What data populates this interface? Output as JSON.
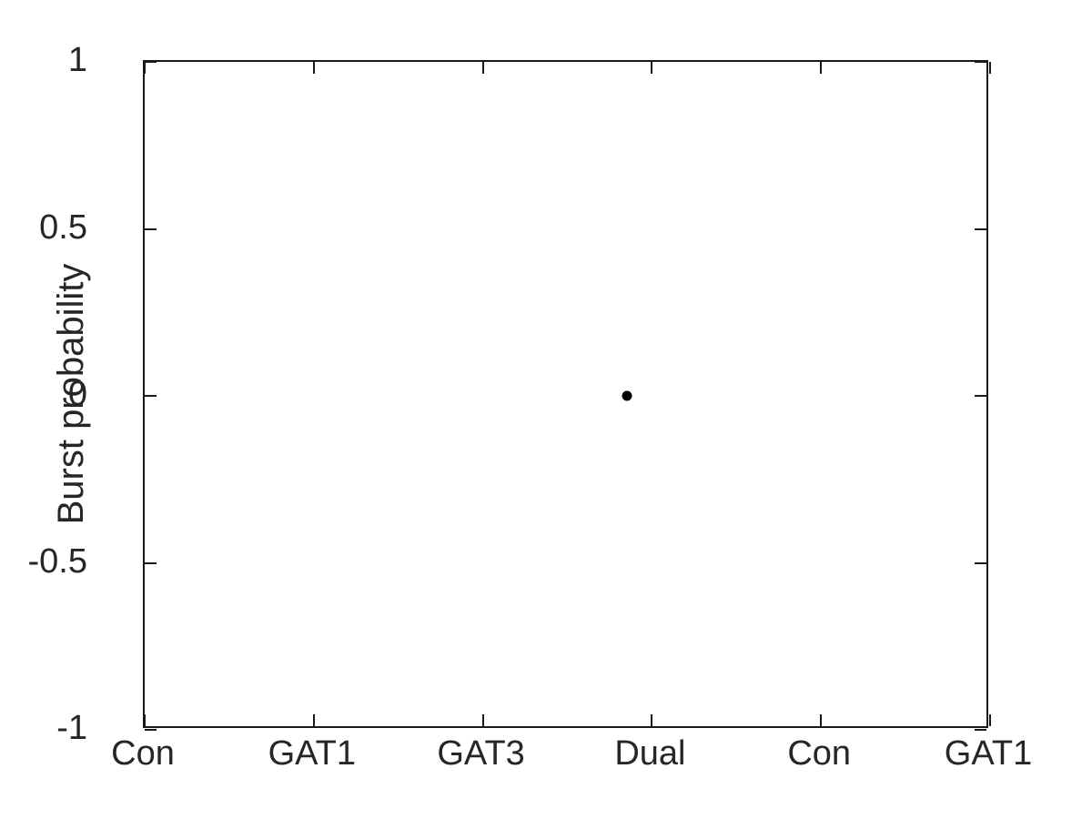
{
  "chart_data": {
    "type": "scatter",
    "title": "",
    "xlabel": "",
    "ylabel": "Burst probability",
    "categories": [
      "Con",
      "GAT1",
      "GAT3",
      "Dual",
      "Con",
      "GAT1"
    ],
    "xtick_labels": [
      "Con",
      "GAT1",
      "GAT3",
      "Dual",
      "Con",
      "GAT1"
    ],
    "ytick_labels": [
      "1",
      "0.5",
      "0",
      "-0.5",
      "-1"
    ],
    "ytick_values": [
      1,
      0.5,
      0,
      -0.5,
      -1
    ],
    "ylim": [
      -1,
      1
    ],
    "xlim": [
      1,
      6
    ],
    "grid": false,
    "legend": false,
    "series": [
      {
        "name": "Burst probability",
        "marker": "filled-circle",
        "color": "#000000",
        "points": [
          {
            "x": 3.855,
            "x_category": "Dual",
            "y": 0
          }
        ]
      }
    ],
    "annotations": []
  },
  "figure": {
    "background_color": "#ffffff",
    "axis_color": "#1a1a1a",
    "text_color": "#262626",
    "marker_color": "#000000"
  }
}
